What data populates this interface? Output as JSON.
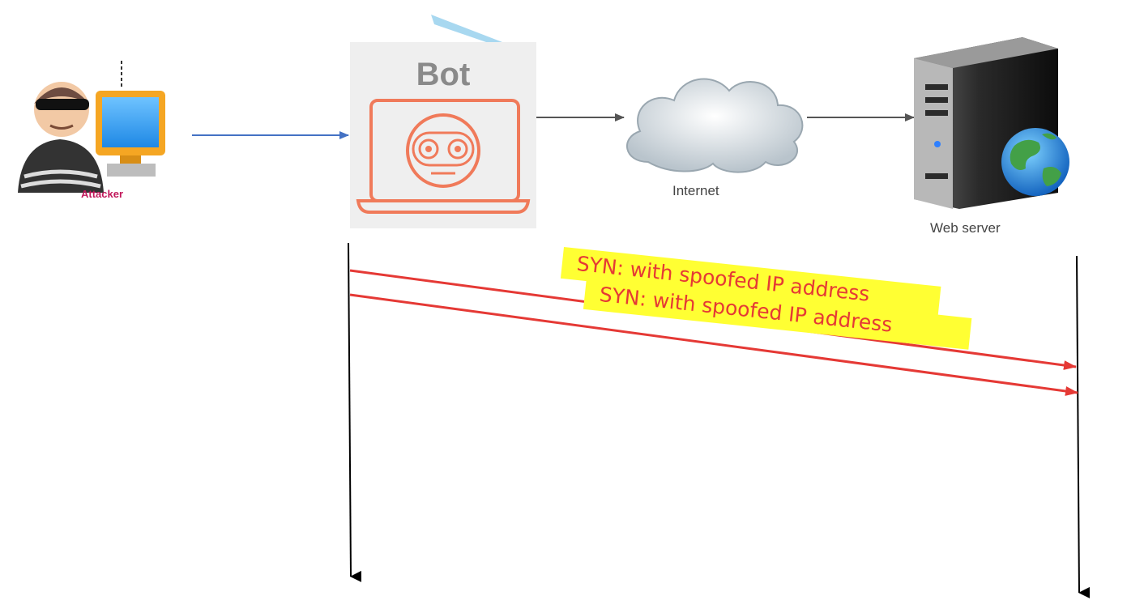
{
  "entities": {
    "attacker": {
      "label": "Attacker"
    },
    "bot": {
      "label": "Bot"
    },
    "internet": {
      "label": "Internet"
    },
    "web_server": {
      "label": "Web server"
    }
  },
  "messages": [
    {
      "text": "SYN: with spoofed IP address",
      "from": "bot",
      "to": "web_server"
    },
    {
      "text": "SYN: with spoofed IP address",
      "from": "bot",
      "to": "web_server"
    }
  ],
  "colors": {
    "message_arrow": "#e53935",
    "message_highlight": "#ffff33",
    "attacker_arrow": "#4472c4",
    "timeline": "#000000",
    "network_arrow": "#555555"
  }
}
